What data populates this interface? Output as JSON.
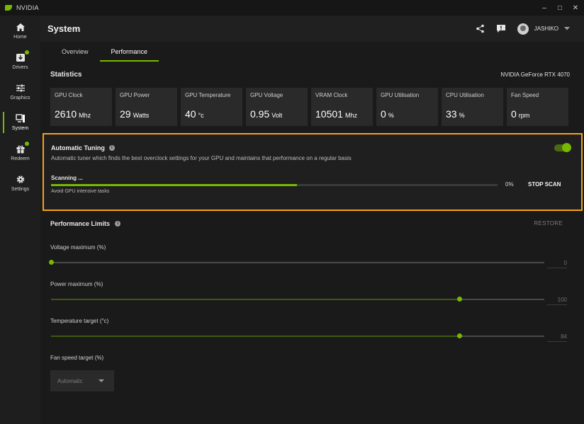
{
  "app": {
    "title": "NVIDIA"
  },
  "window_controls": {
    "minimize": "–",
    "maximize": "□",
    "close": "✕"
  },
  "sidebar": {
    "items": [
      {
        "label": "Home",
        "icon": "home-icon",
        "active": false,
        "badge": false
      },
      {
        "label": "Drivers",
        "icon": "download-icon",
        "active": false,
        "badge": true
      },
      {
        "label": "Graphics",
        "icon": "sliders-icon",
        "active": false,
        "badge": false
      },
      {
        "label": "System",
        "icon": "monitor-icon",
        "active": true,
        "badge": false
      },
      {
        "label": "Redeem",
        "icon": "gift-icon",
        "active": false,
        "badge": true
      },
      {
        "label": "Settings",
        "icon": "gear-icon",
        "active": false,
        "badge": false
      }
    ]
  },
  "header": {
    "title": "System",
    "user": "JASHIKO"
  },
  "tabs": [
    {
      "label": "Overview",
      "active": false
    },
    {
      "label": "Performance",
      "active": true
    }
  ],
  "statistics": {
    "title": "Statistics",
    "gpu_name": "NVIDIA GeForce RTX 4070",
    "items": [
      {
        "label": "GPU Clock",
        "value": "2610",
        "unit": "Mhz"
      },
      {
        "label": "GPU Power",
        "value": "29",
        "unit": "Watts"
      },
      {
        "label": "GPU Temperature",
        "value": "40",
        "unit": "°c"
      },
      {
        "label": "GPU Voltage",
        "value": "0.95",
        "unit": "Volt"
      },
      {
        "label": "VRAM Clock",
        "value": "10501",
        "unit": "Mhz"
      },
      {
        "label": "GPU Utilisation",
        "value": "0",
        "unit": "%"
      },
      {
        "label": "CPU Utilisation",
        "value": "33",
        "unit": "%"
      },
      {
        "label": "Fan Speed",
        "value": "0",
        "unit": "rpm"
      }
    ]
  },
  "auto_tuning": {
    "title": "Automatic Tuning",
    "description": "Automatic tuner which finds the best overclock settings for your GPU and maintains that performance on a regular basis",
    "enabled": true,
    "status": "Scanning ...",
    "progress_percent_label": "0%",
    "progress_fill_fraction": 0.55,
    "hint": "Avoid GPU intensive tasks",
    "stop_label": "STOP SCAN"
  },
  "performance_limits": {
    "title": "Performance Limits",
    "restore_label": "RESTORE",
    "sliders": [
      {
        "label": "Voltage maximum (%)",
        "value": "0",
        "fraction": 0.0
      },
      {
        "label": "Power maximum (%)",
        "value": "100",
        "fraction": 0.828
      },
      {
        "label": "Temperature target (°c)",
        "value": "84",
        "fraction": 0.827
      }
    ],
    "fan": {
      "label": "Fan speed target (%)",
      "selected": "Automatic"
    }
  },
  "colors": {
    "accent": "#76b900",
    "highlight_border": "#f5a21b"
  }
}
